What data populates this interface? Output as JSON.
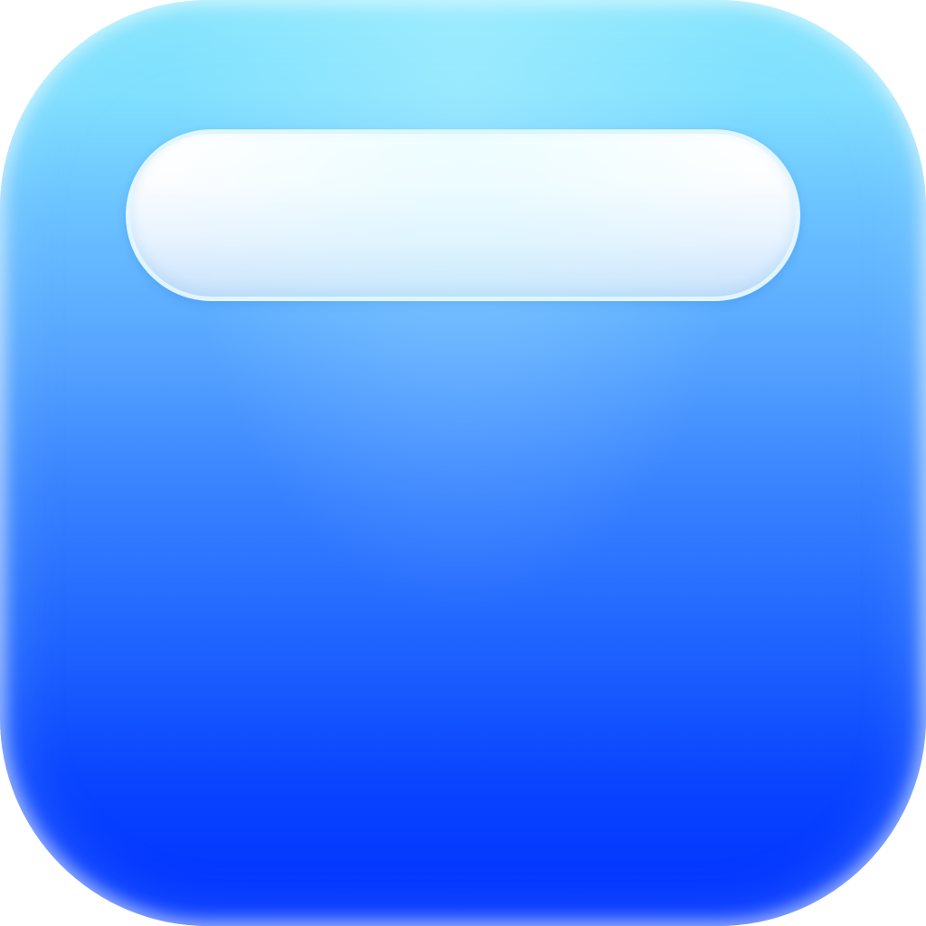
{
  "icon": {
    "name": "app-icon",
    "colors": {
      "top": "#86e6fd",
      "middle": "#4c99ff",
      "bottom": "#0030ff",
      "pill_top": "#ffffff",
      "pill_bottom": "#c9e2fb"
    }
  }
}
